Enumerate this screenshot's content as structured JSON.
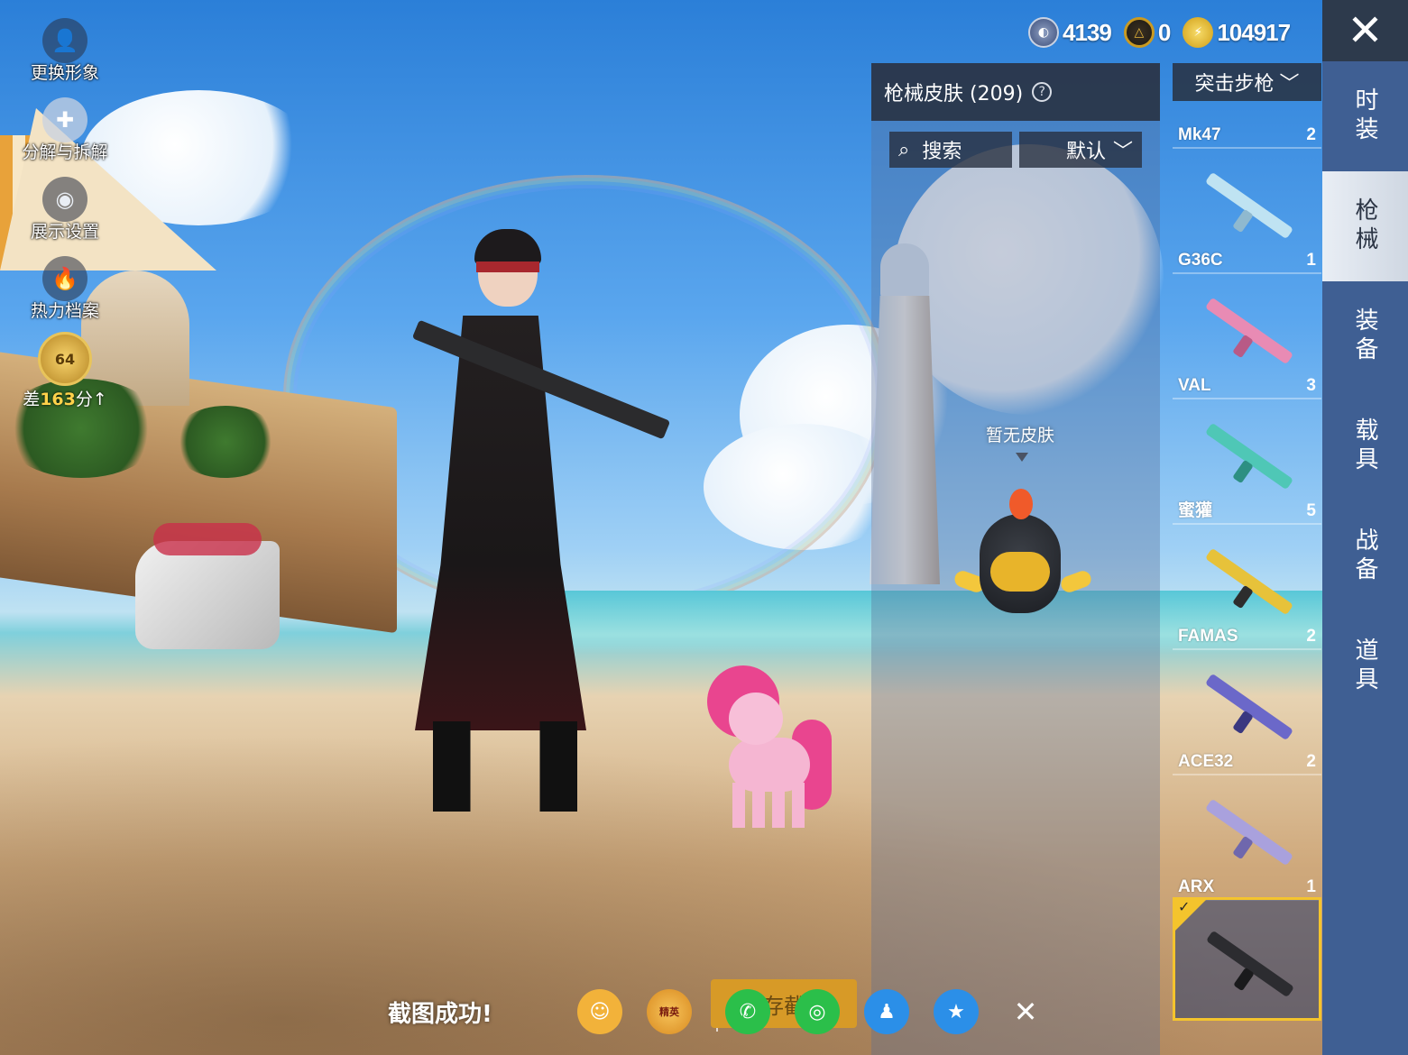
{
  "currency": [
    {
      "icon": "silver-coin-icon",
      "value": "4139",
      "color": "#3b4d7a"
    },
    {
      "icon": "gold-token-icon",
      "value": "0",
      "color": "#c99a22"
    },
    {
      "icon": "lightning-coin-icon",
      "value": "104917",
      "color": "#e3b21f"
    }
  ],
  "close_icon": "✕",
  "left_tools": [
    {
      "label": "更换形象",
      "icon": "avatar-icon"
    },
    {
      "label": "分解与拆解",
      "icon": "puzzle-icon"
    },
    {
      "label": "展示设置",
      "icon": "eye-icon"
    },
    {
      "label": "热力档案",
      "icon": "flame-icon"
    }
  ],
  "rank": {
    "level": "64",
    "hint_prefix": "差",
    "hint_value": "163",
    "hint_suffix": "分"
  },
  "skins_panel": {
    "title": "枪械皮肤 (209)",
    "help": "?",
    "search_label": "搜索",
    "sort_label": "默认",
    "empty_text": "暂无皮肤"
  },
  "category": "突击步枪",
  "weapons": [
    {
      "name": "Mk47",
      "count": "2",
      "color": "#6e7d8f"
    },
    {
      "name": "G36C",
      "count": "1",
      "color": "#bfe3f2"
    },
    {
      "name": "VAL",
      "count": "3",
      "color": "#e88bb4"
    },
    {
      "name": "蜜獾",
      "count": "5",
      "color": "#4fc7b6"
    },
    {
      "name": "FAMAS",
      "count": "2",
      "color": "#e7c23a"
    },
    {
      "name": "ACE32",
      "count": "2",
      "color": "#6b68c9"
    },
    {
      "name": "ARX",
      "count": "1",
      "color": "#a9a1dd"
    }
  ],
  "selected_weapon": {
    "color": "#2c2c30"
  },
  "side_tabs": [
    {
      "label": "时装",
      "active": false
    },
    {
      "label": "枪械",
      "active": true
    },
    {
      "label": "装备",
      "active": false
    },
    {
      "label": "载具",
      "active": false
    },
    {
      "label": "战备",
      "active": false
    },
    {
      "label": "道具",
      "active": false
    }
  ],
  "share": {
    "success_text": "截图成功!",
    "save_label": "保存截图",
    "buttons": [
      {
        "name": "friends-share-icon",
        "glyph": "☺",
        "color": "#f2b23a"
      },
      {
        "name": "peace-elite-icon",
        "glyph": "和平精英",
        "color": "#d98a1f"
      },
      {
        "name": "wechat-icon",
        "glyph": "✆",
        "color": "#2bbf4a"
      },
      {
        "name": "moments-icon",
        "glyph": "◎",
        "color": "#2bbf4a"
      },
      {
        "name": "qq-icon",
        "glyph": "♟",
        "color": "#2b8fe8"
      },
      {
        "name": "qzone-icon",
        "glyph": "★",
        "color": "#2b8fe8"
      },
      {
        "name": "close-share-icon",
        "glyph": "✕",
        "color": "transparent"
      }
    ]
  }
}
